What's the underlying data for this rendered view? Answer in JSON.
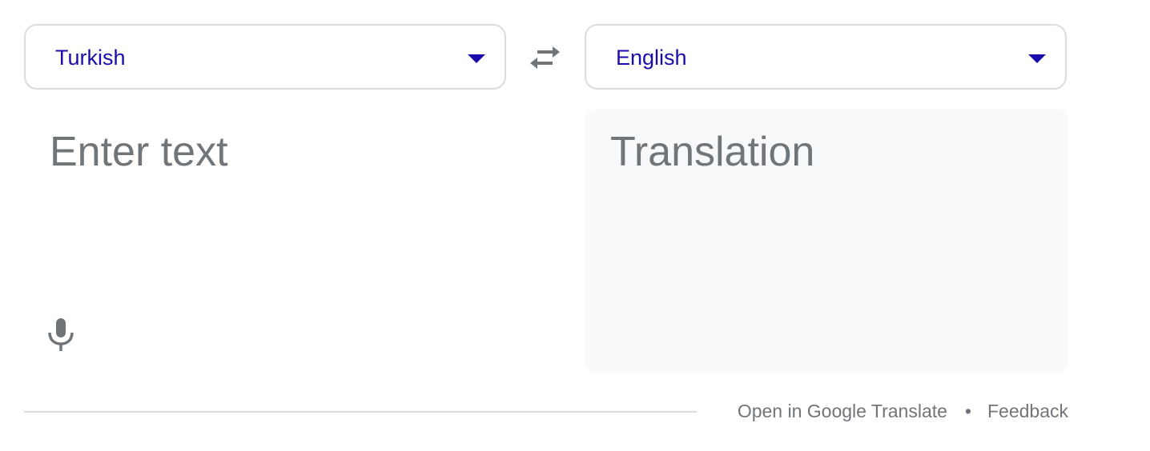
{
  "source_language": {
    "label": "Turkish",
    "dropdown_icon": "triangle-down-icon"
  },
  "target_language": {
    "label": "English",
    "dropdown_icon": "triangle-down-icon"
  },
  "swap": {
    "icon": "swap-arrows-icon"
  },
  "source_input": {
    "placeholder": "Enter text",
    "value": "",
    "mic_icon": "microphone-icon"
  },
  "translation": {
    "placeholder": "Translation"
  },
  "footer": {
    "open_link": "Open in Google Translate",
    "separator": "•",
    "feedback_link": "Feedback"
  },
  "colors": {
    "language_text": "#1a0dab",
    "placeholder_text": "#70757a",
    "border": "#dadce0",
    "output_background": "#f8f9fa",
    "icon": "#70757a"
  }
}
